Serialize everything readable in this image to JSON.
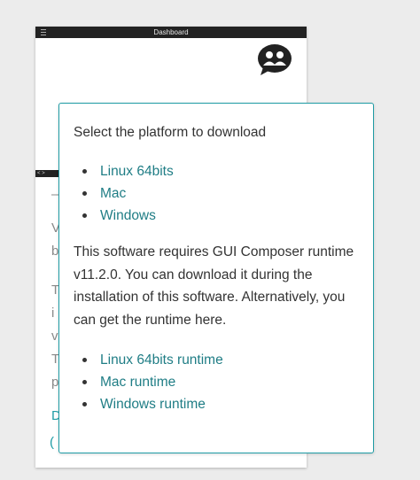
{
  "app": {
    "title": "Dashboard",
    "subbar_label": "<  >"
  },
  "popup": {
    "heading": "Select the platform to download",
    "platforms": [
      {
        "label": "Linux 64bits"
      },
      {
        "label": "Mac"
      },
      {
        "label": "Windows"
      }
    ],
    "note": "This software requires GUI Composer runtime v11.2.0. You can download it during the installation of this software. Alternatively, you can get the runtime here.",
    "runtimes": [
      {
        "label": "Linux 64bits runtime"
      },
      {
        "label": "Mac runtime"
      },
      {
        "label": "Windows runtime"
      }
    ]
  },
  "colors": {
    "accent": "#1f9ca5",
    "link": "#1f7d85",
    "titlebar": "#222222",
    "background": "#ececec"
  }
}
